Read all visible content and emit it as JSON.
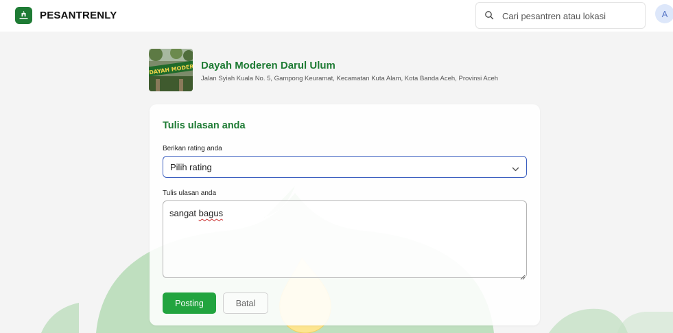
{
  "app": {
    "brand": "PESANTRENLY",
    "brand_color": "#1e7b34"
  },
  "search": {
    "placeholder": "Cari pesantren atau lokasi",
    "icon": "search-icon"
  },
  "user": {
    "avatar_initial": "A"
  },
  "place": {
    "name": "Dayah Moderen Darul Ulum",
    "address": "Jalan Syiah Kuala No. 5, Gampong Keuramat, Kecamatan Kuta Alam, Kota Banda Aceh, Provinsi Aceh",
    "thumb_sign_text": "DAYAH MODERN D"
  },
  "review_form": {
    "title": "Tulis ulasan anda",
    "rating_label": "Berikan rating anda",
    "rating_value": "Pilih rating",
    "review_label": "Tulis ulasan anda",
    "review_text_prefix": "sangat ",
    "review_text_misspelled": "bagus",
    "post_label": "Posting",
    "cancel_label": "Batal"
  },
  "colors": {
    "primary_green": "#22a43f",
    "focus_blue": "#3c5fc0",
    "deco_green": "#b5dab5",
    "deco_yellow": "#fde58f"
  }
}
